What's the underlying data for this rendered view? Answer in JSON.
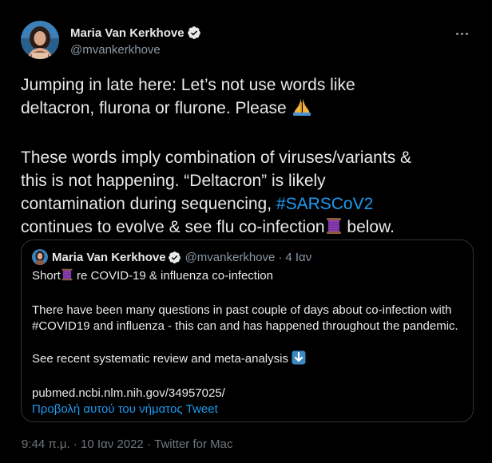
{
  "author": {
    "display_name": "Maria Van Kerkhove",
    "handle": "@mvankerkhove"
  },
  "tweet": {
    "line1": "Jumping in late here: Let’s not use words like",
    "line2_pre": "deltacron, flurona or flurone. Please ",
    "para2_line1": "These words imply combination of viruses/variants &",
    "para2_line2": "this is not happening. “Deltacron” is likely",
    "para2_line3_pre": "contamination during sequencing, ",
    "hashtag": "#SARSCoV2",
    "para2_line4_pre": "continues to evolve & see flu co-infection",
    "para2_line4_post": " below."
  },
  "quoted": {
    "display_name": "Maria Van Kerkhove",
    "handle": "@mvankerkhove",
    "separator": "·",
    "time": "4 Ιαν",
    "line1_pre": "Short",
    "line1_post": " re COVID-19 & influenza co-infection",
    "para2_line1": "There have been many questions in past couple of days about co-infection with",
    "para2_line2": "#COVID19 and influenza - this can and has happened throughout the pandemic.",
    "para3": "See recent systematic review and meta-analysis ",
    "url": "pubmed.ncbi.nlm.nih.gov/34957025/",
    "show_thread": "Προβολή αυτού του νήματος Tweet"
  },
  "footer": {
    "time": "9:44 π.μ.",
    "separator1": " · ",
    "date": "10 Ιαν 2022",
    "separator2": " · ",
    "source": "Twitter for Mac"
  },
  "icons": {
    "verified": "verified-badge-icon",
    "praying_hands": "praying-hands-emoji",
    "thread": "thread-spool-emoji",
    "down_arrow": "down-arrow-emoji",
    "more": "more-options-icon"
  },
  "colors": {
    "background": "#000000",
    "text": "#e7e9ea",
    "secondary": "#8b98a5",
    "link": "#1d9bf0",
    "border": "#2f3336"
  }
}
